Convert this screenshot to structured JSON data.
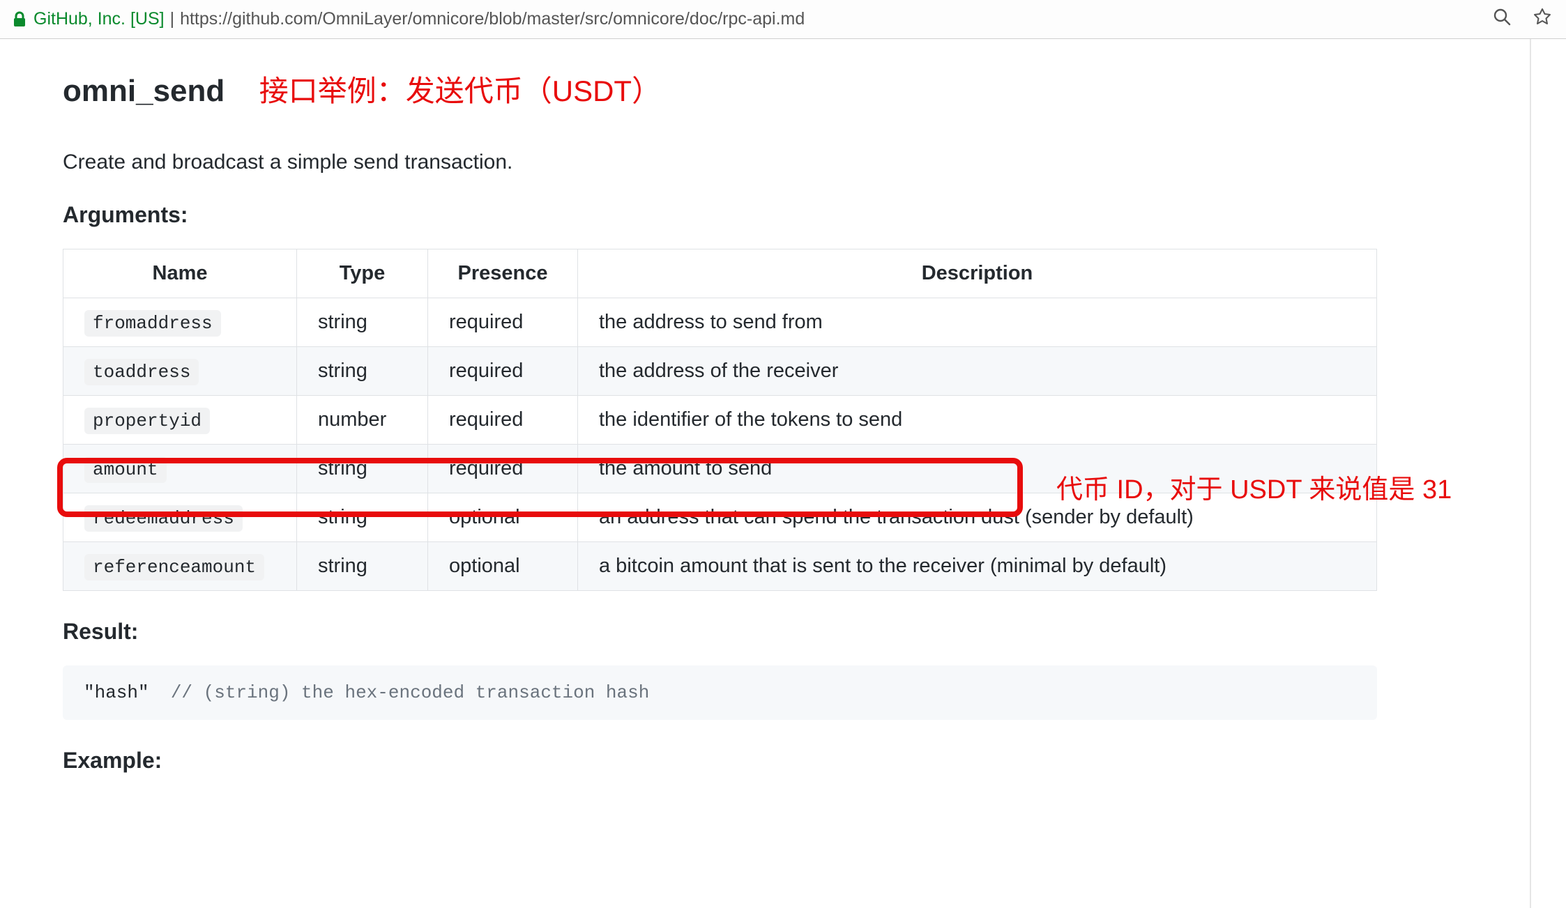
{
  "browser": {
    "secure_org": "GitHub, Inc. [US]",
    "url": "https://github.com/OmniLayer/omnicore/blob/master/src/omnicore/doc/rpc-api.md"
  },
  "heading": "omni_send",
  "heading_annotation": "接口举例：发送代币（USDT）",
  "description": "Create and broadcast a simple send transaction.",
  "arguments_label": "Arguments:",
  "table": {
    "headers": {
      "name": "Name",
      "type": "Type",
      "presence": "Presence",
      "description": "Description"
    },
    "rows": [
      {
        "name": "fromaddress",
        "type": "string",
        "presence": "required",
        "description": "the address to send from"
      },
      {
        "name": "toaddress",
        "type": "string",
        "presence": "required",
        "description": "the address of the receiver"
      },
      {
        "name": "propertyid",
        "type": "number",
        "presence": "required",
        "description": "the identifier of the tokens to send"
      },
      {
        "name": "amount",
        "type": "string",
        "presence": "required",
        "description": "the amount to send"
      },
      {
        "name": "redeemaddress",
        "type": "string",
        "presence": "optional",
        "description": "an address that can spend the transaction dust (sender by default)"
      },
      {
        "name": "referenceamount",
        "type": "string",
        "presence": "optional",
        "description": "a bitcoin amount that is sent to the receiver (minimal by default)"
      }
    ]
  },
  "row_annotation": "代币 ID，对于 USDT 来说值是 31",
  "result_label": "Result:",
  "result_code_string": "\"hash\"",
  "result_code_comment": "  // (string) the hex-encoded transaction hash",
  "example_label": "Example:"
}
